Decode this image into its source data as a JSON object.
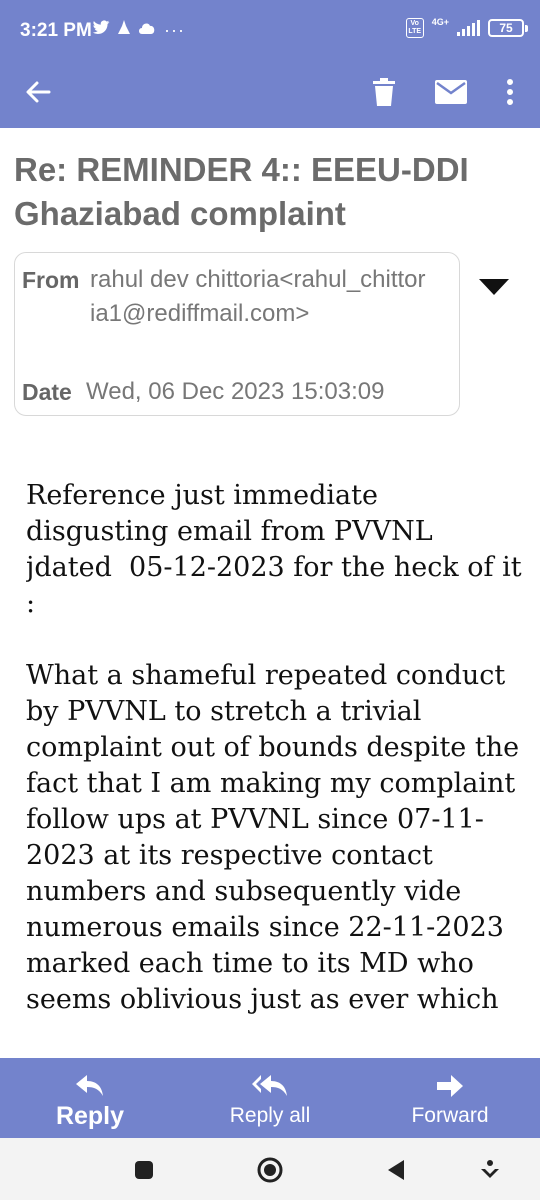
{
  "status_bar": {
    "time": "3:21 PM",
    "volte": "Vo LTE",
    "network": "4G+",
    "battery": "75",
    "left_icons": [
      "twitter-icon",
      "notification-icon",
      "cloud-icon",
      "more-dots-icon"
    ]
  },
  "app_bar": {
    "icons": [
      "back-arrow-icon",
      "trash-icon",
      "mail-icon",
      "more-vert-icon"
    ]
  },
  "email": {
    "subject": "Re: REMINDER 4:: EEEU-DDI Ghaziabad complaint",
    "from_label": "From",
    "from_value": "rahul dev chittoria<rahul_chittoria1@rediffmail.com>",
    "date_label": "Date",
    "date_value": "Wed, 06 Dec 2023 15:03:09",
    "body": "Reference just immediate disgusting email from PVVNL jdated  05-12-2023 for the heck of it :\n\nWhat a shameful repeated conduct by PVVNL to stretch a trivial complaint out of bounds despite the fact that I am making my complaint follow ups at PVVNL since 07-11-2023 at its respective contact numbers and subsequently vide numerous emails since 22-11-2023 marked each time to its MD who seems oblivious just as ever which"
  },
  "actions": {
    "reply": "Reply",
    "reply_all": "Reply all",
    "forward": "Forward"
  },
  "colors": {
    "accent": "#7383cc",
    "subject_text": "#6b6b6b"
  }
}
